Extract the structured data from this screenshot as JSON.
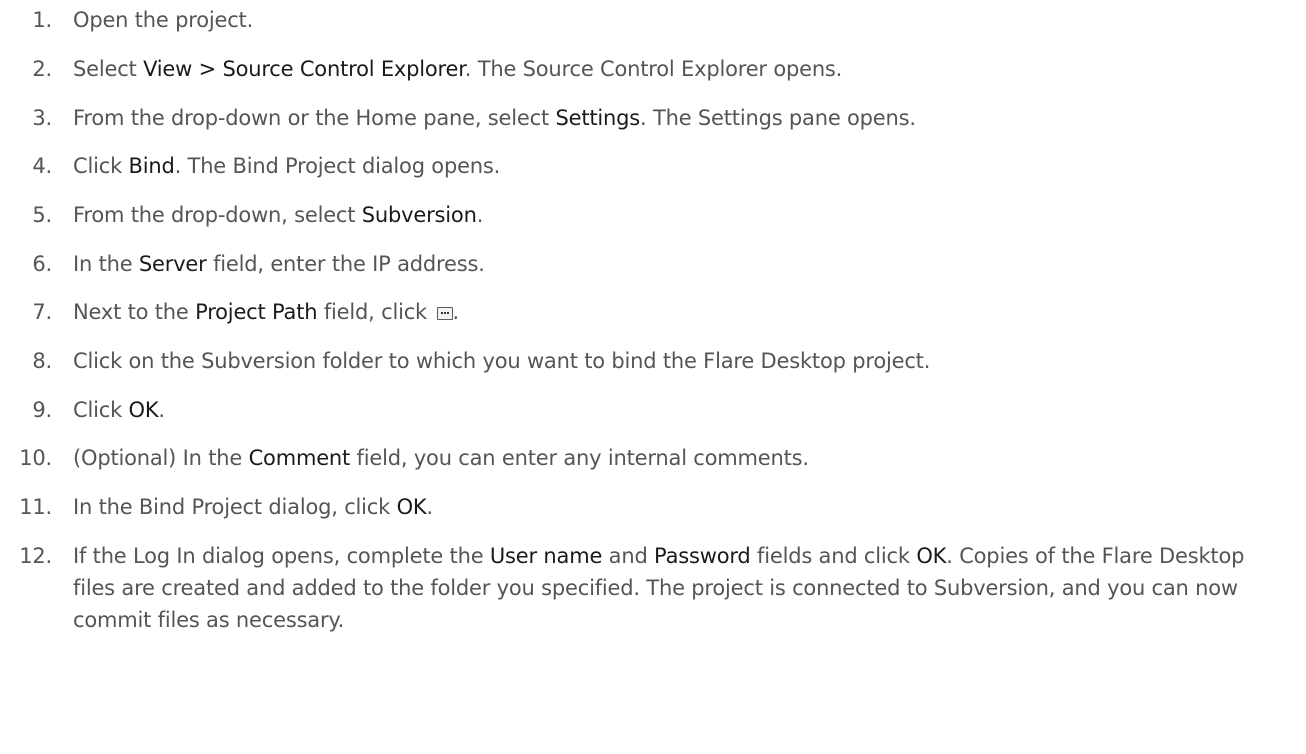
{
  "steps": [
    {
      "num": "1.",
      "parts": [
        {
          "text": "Open the project."
        }
      ]
    },
    {
      "num": "2.",
      "parts": [
        {
          "text": "Select "
        },
        {
          "text": "View > Source Control Explorer",
          "strong": true
        },
        {
          "text": ". The Source Control Explorer opens."
        }
      ]
    },
    {
      "num": "3.",
      "parts": [
        {
          "text": "From the drop-down or the Home pane, select "
        },
        {
          "text": "Settings",
          "strong": true
        },
        {
          "text": ". The Settings pane opens."
        }
      ]
    },
    {
      "num": "4.",
      "parts": [
        {
          "text": "Click "
        },
        {
          "text": "Bind",
          "strong": true
        },
        {
          "text": ". The Bind Project dialog opens."
        }
      ]
    },
    {
      "num": "5.",
      "parts": [
        {
          "text": "From the drop-down, select "
        },
        {
          "text": "Subversion",
          "strong": true
        },
        {
          "text": "."
        }
      ]
    },
    {
      "num": "6.",
      "parts": [
        {
          "text": "In the "
        },
        {
          "text": "Server",
          "strong": true
        },
        {
          "text": " field, enter the IP address."
        }
      ]
    },
    {
      "num": "7.",
      "parts": [
        {
          "text": "Next to the "
        },
        {
          "text": "Project Path",
          "strong": true
        },
        {
          "text": " field, click "
        },
        {
          "icon": "browse-ellipsis-icon"
        },
        {
          "text": "."
        }
      ]
    },
    {
      "num": "8.",
      "parts": [
        {
          "text": "Click on the Subversion folder to which you want to bind the Flare Desktop project."
        }
      ]
    },
    {
      "num": "9.",
      "parts": [
        {
          "text": "Click "
        },
        {
          "text": "OK",
          "strong": true
        },
        {
          "text": "."
        }
      ]
    },
    {
      "num": "10.",
      "parts": [
        {
          "text": "(Optional) In the "
        },
        {
          "text": "Comment",
          "strong": true
        },
        {
          "text": " field, you can enter any internal comments."
        }
      ]
    },
    {
      "num": "11.",
      "parts": [
        {
          "text": "In the Bind Project dialog, click "
        },
        {
          "text": "OK",
          "strong": true
        },
        {
          "text": "."
        }
      ]
    },
    {
      "num": "12.",
      "parts": [
        {
          "text": "If the Log In dialog opens, complete the "
        },
        {
          "text": "User name",
          "strong": true
        },
        {
          "text": " and "
        },
        {
          "text": "Password",
          "strong": true
        },
        {
          "text": " fields and click "
        },
        {
          "text": "OK",
          "strong": true
        },
        {
          "text": ". Copies of the Flare Desktop files are created and added to the folder you specified. The project is connected to Subversion, and you can now commit files as necessary."
        }
      ]
    }
  ]
}
